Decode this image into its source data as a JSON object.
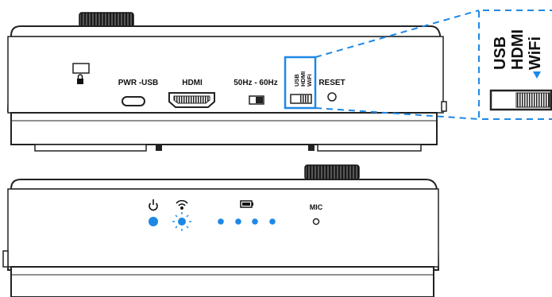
{
  "back_panel": {
    "ports": {
      "pwr_usb": "PWR -USB",
      "hdmi": "HDMI",
      "freq": "50Hz - 60Hz",
      "reset": "RESET"
    },
    "mode_switch": {
      "options": [
        "USB",
        "HDMI",
        "WiFi"
      ]
    }
  },
  "zoom_callout": {
    "options": [
      "USB",
      "HDMI",
      "WiFi"
    ],
    "accent_color": "#1e88e5"
  },
  "front_panel": {
    "mic_label": "MIC",
    "leds": {
      "power": "on",
      "wifi": "blinking",
      "battery_dots": 4
    }
  },
  "icons": [
    "lock-icon",
    "power-icon",
    "wifi-icon",
    "battery-icon"
  ]
}
